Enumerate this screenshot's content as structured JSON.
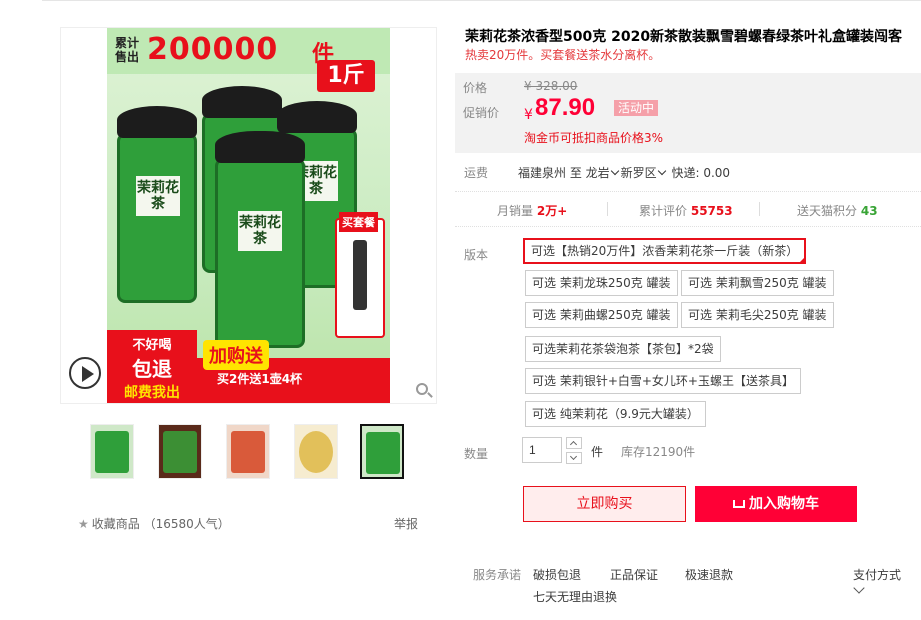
{
  "product": {
    "title": "茉莉花茶浓香型500克 2020新茶散装飘雪碧螺春绿茶叶礼盒罐装闯客",
    "subtitle": "热卖20万件。买套餐送茶水分离杯。"
  },
  "gallery": {
    "banner_label": "累计售出",
    "banner_number": "200000",
    "banner_unit": "件",
    "weight_tag": "1斤",
    "can_label": "茉莉花茶",
    "gift_tag": "买套餐",
    "no_good_line1": "不好喝",
    "no_good_line2": "包退",
    "no_good_line3": "邮费我出",
    "add_buy": "加购送",
    "bottom_text": "买2件送1壶4杯",
    "thumbnail_count": 5,
    "active_thumbnail": 5
  },
  "price": {
    "orig_label": "价格",
    "orig_value": "¥ 328.00",
    "promo_label": "促销价",
    "currency": "¥",
    "promo_value": "87.90",
    "promo_tag": "活动中",
    "taojin": "淘金币可抵扣商品价格3%"
  },
  "shipping": {
    "label": "运费",
    "from": "福建泉州 至 龙岩",
    "district": "新罗区",
    "method": "快递: 0.00"
  },
  "stats": {
    "monthly_label": "月销量",
    "monthly_value": "2万+",
    "reviews_label": "累计评价",
    "reviews_value": "55753",
    "points_label": "送天猫积分",
    "points_value": "43"
  },
  "versions": {
    "label": "版本",
    "options": [
      "可选【热销20万件】浓香茉莉花茶一斤装（新茶）",
      "可选 茉莉龙珠250克 罐装",
      "可选 茉莉飘雪250克 罐装",
      "可选 茉莉曲螺250克 罐装",
      "可选 茉莉毛尖250克 罐装",
      "可选茉莉花茶袋泡茶【茶包】*2袋",
      "可选 茉莉银针+白雪+女儿环+玉螺王【送茶具】",
      "可选 纯茉莉花（9.9元大罐装）"
    ],
    "selected_index": 0
  },
  "quantity": {
    "label": "数量",
    "value": "1",
    "unit": "件",
    "stock": "库存12190件"
  },
  "actions": {
    "buy_now": "立即购买",
    "add_cart": "加入购物车"
  },
  "favorites": {
    "label": "收藏商品",
    "count": "（16580人气）",
    "report": "举报"
  },
  "service": {
    "label": "服务承诺",
    "items": [
      "破损包退",
      "正品保证",
      "极速退款",
      "七天无理由退换"
    ],
    "pay_label": "支付方式"
  },
  "colors": {
    "accent": "#ff0036",
    "tmall_red": "#e8101b",
    "green": "#39a436"
  }
}
